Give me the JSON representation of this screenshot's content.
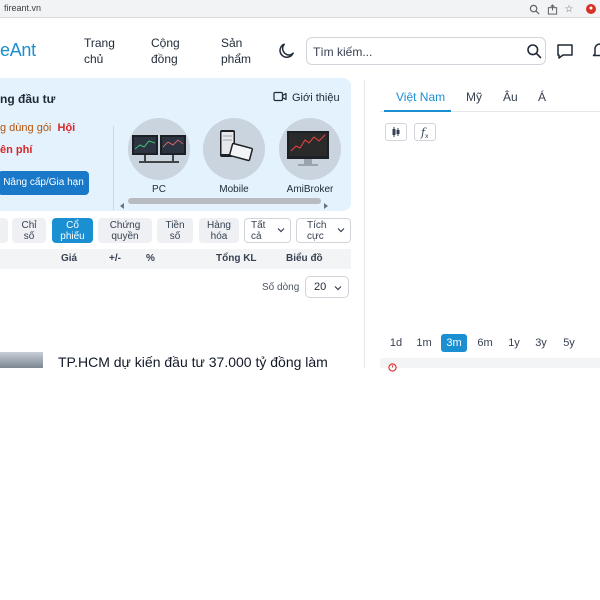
{
  "browser": {
    "url": "fireant.vn",
    "icons": [
      "zoom-icon",
      "share-icon",
      "star-icon",
      "extension-icon"
    ]
  },
  "header": {
    "logo": "eAnt",
    "nav": [
      {
        "line1": "Trang",
        "line2": "chủ"
      },
      {
        "line1": "Cộng",
        "line2": "đồng"
      },
      {
        "line1": "Sản",
        "line2": "phẩm"
      }
    ],
    "search_placeholder": "Tìm kiếm..."
  },
  "promo": {
    "title": "ng đầu tư",
    "line1_text": "g dùng gói",
    "line1_highlight": "Hội",
    "line2": "ên phí",
    "button": "Nâng cấp/Gia hạn",
    "intro": "Giới thiệu",
    "devices": [
      "PC",
      "Mobile",
      "AmiBroker"
    ]
  },
  "filters": {
    "chips": [
      {
        "l1": "Chỉ",
        "l2": "số",
        "active": false
      },
      {
        "l1": "Cổ",
        "l2": "phiếu",
        "active": true
      },
      {
        "l1": "Chứng",
        "l2": "quyền",
        "active": false
      },
      {
        "l1": "Tiền",
        "l2": "số",
        "active": false
      },
      {
        "l1": "Hàng",
        "l2": "hóa",
        "active": false
      }
    ],
    "dropdowns": [
      {
        "l1": "Tất",
        "l2": "cả"
      },
      {
        "l1": "Tích",
        "l2": "cực"
      }
    ]
  },
  "table": {
    "columns": [
      "Giá",
      "+/-",
      "%",
      "Tổng KL",
      "Biểu đồ"
    ],
    "rows_label": "Số dòng",
    "rows_value": "20"
  },
  "news": {
    "title": "TP.HCM dự kiến đầu tư 37.000 tỷ đồng làm"
  },
  "market": {
    "tabs": [
      "Việt Nam",
      "Mỹ",
      "Âu",
      "Á"
    ],
    "active_tab": "Việt Nam",
    "tools": [
      "candlestick-icon",
      "function-icon"
    ],
    "ranges": [
      "1d",
      "1m",
      "3m",
      "6m",
      "1y",
      "3y",
      "5y"
    ],
    "active_range": "3m"
  },
  "colors": {
    "accent": "#1a8fd1",
    "promo_bg": "#e3f2fd",
    "button": "#1978c8",
    "highlight_red": "#dc2626"
  }
}
